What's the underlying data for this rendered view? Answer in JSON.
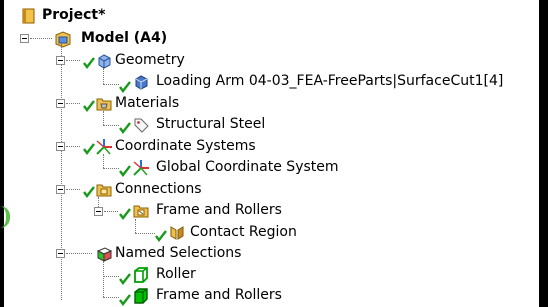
{
  "tree": {
    "project": "Project*",
    "model": "Model (A4)",
    "geometry": "Geometry",
    "geometry_part": "Loading Arm 04-03_FEA-FreeParts|SurfaceCut1[4]",
    "materials": "Materials",
    "material_item": "Structural Steel",
    "coordinate_systems": "Coordinate Systems",
    "global_cs": "Global Coordinate System",
    "connections": "Connections",
    "frame_and_rollers": "Frame and Rollers",
    "contact_region": "Contact Region",
    "named_selections": "Named Selections",
    "roller": "Roller",
    "frame_and_rollers_ns": "Frame and Rollers"
  },
  "icons": {
    "project": "project-book-icon",
    "model": "model-icon",
    "geometry": "geometry-cube-icon",
    "part": "part-cube-icon",
    "materials": "materials-folder-icon",
    "material": "material-tag-icon",
    "coordinate_systems": "coordinate-axes-icon",
    "connections": "connections-folder-icon",
    "connection_group": "connection-group-icon",
    "contact": "contact-region-icon",
    "named_selections": "named-selections-icon",
    "selection_outline": "selection-outline-icon",
    "selection_filled": "selection-filled-icon",
    "check": "check-icon"
  },
  "colors": {
    "check": "#1a9a1a",
    "selection_green": "#00b000",
    "folder": "#f0c050",
    "cube_blue": "#4a78c8"
  }
}
